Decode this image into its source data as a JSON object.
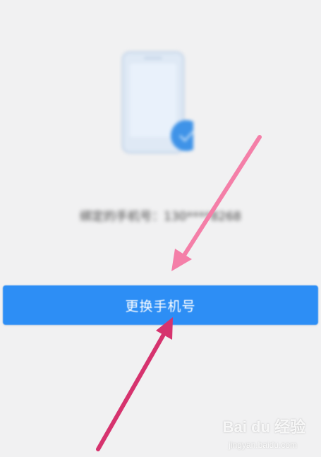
{
  "bound_phone_text": "绑定的手机号：130****8268",
  "change_phone_button_label": "更换手机号",
  "watermark": {
    "brand": "Bai du 经验",
    "url": "jingyan.baidu.com"
  },
  "colors": {
    "primary_button": "#2d8ef5",
    "arrow_light": "#f47fa8",
    "arrow_dark": "#d6336e",
    "background": "#f1f1f2"
  },
  "icons": [
    "phone-illustration-icon",
    "arrow-annotation"
  ]
}
